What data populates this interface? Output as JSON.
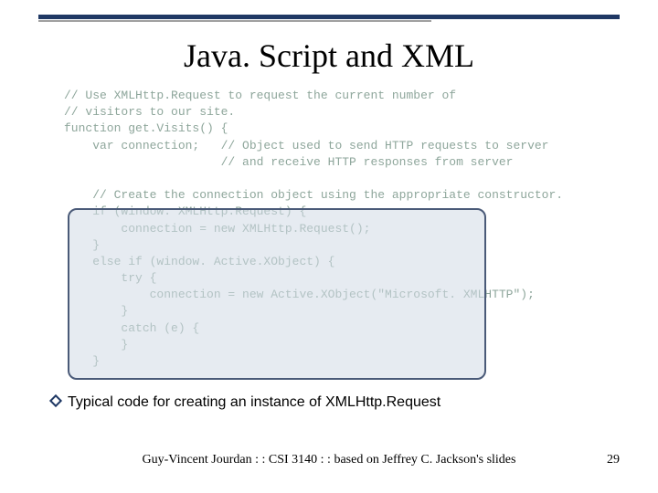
{
  "title": "Java. Script and XML",
  "code": "// Use XMLHttp.Request to request the current number of\n// visitors to our site.\nfunction get.Visits() {\n    var connection;   // Object used to send HTTP requests to server\n                      // and receive HTTP responses from server\n\n    // Create the connection object using the appropriate constructor.\n    if (window. XMLHttp.Request) {\n        connection = new XMLHttp.Request();\n    }\n    else if (window. Active.XObject) {\n        try {\n            connection = new Active.XObject(\"Microsoft. XMLHTTP\");\n        }\n        catch (e) {\n        }\n    }",
  "caption": "Typical code for creating an instance of XMLHttp.Request",
  "footer": "Guy-Vincent Jourdan : : CSI 3140 : : based on Jeffrey C. Jackson's slides",
  "page_number": "29"
}
